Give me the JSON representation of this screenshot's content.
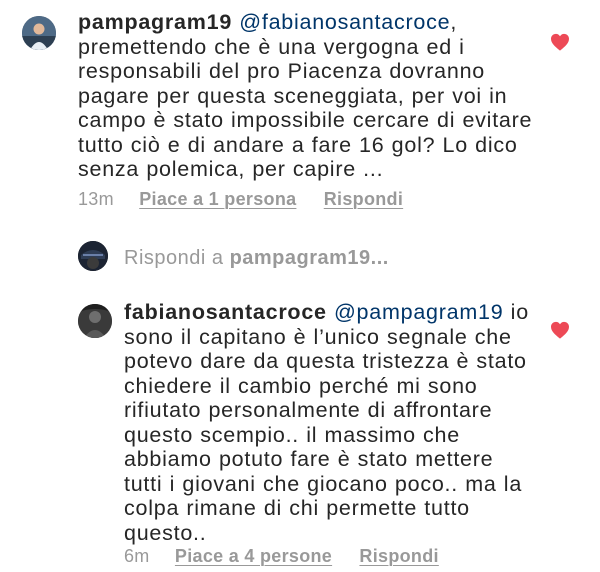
{
  "comment1": {
    "username": "pampagram19",
    "mention": "@fabianosantacroce",
    "lines": [
      ",",
      "premettendo che è una vergogna ed i",
      "responsabili del pro Piacenza dovranno",
      "pagare per questa sceneggiata, per voi in",
      "campo è stato impossibile cercare di evitare",
      "tutto ciò e di andare a fare 16 gol? Lo dico",
      "senza polemica, per capire ..."
    ],
    "time": "13m",
    "likes": "Piace a 1 persona",
    "reply": "Rispondi",
    "heart_icon": "heart-icon",
    "heart_color": "#ed4956"
  },
  "reply_prompt": {
    "prefix": "Rispondi a ",
    "target": "pampagram19..."
  },
  "comment2": {
    "username": "fabianosantacroce",
    "mention": "@pampagram19",
    "lines": [
      " io",
      "sono il capitano è l’unico segnale che",
      "potevo dare da questa tristezza è stato",
      "chiedere il cambio perché mi sono",
      "rifiutato personalmente di affrontare",
      "questo scempio.. il massimo che",
      "abbiamo potuto fare è stato mettere",
      "tutti i giovani che giocano poco.. ma la",
      "colpa rimane di chi permette tutto",
      "questo.."
    ],
    "time": "6m",
    "likes": "Piace a 4 persone",
    "reply": "Rispondi",
    "heart_icon": "heart-icon",
    "heart_color": "#ed4956"
  }
}
